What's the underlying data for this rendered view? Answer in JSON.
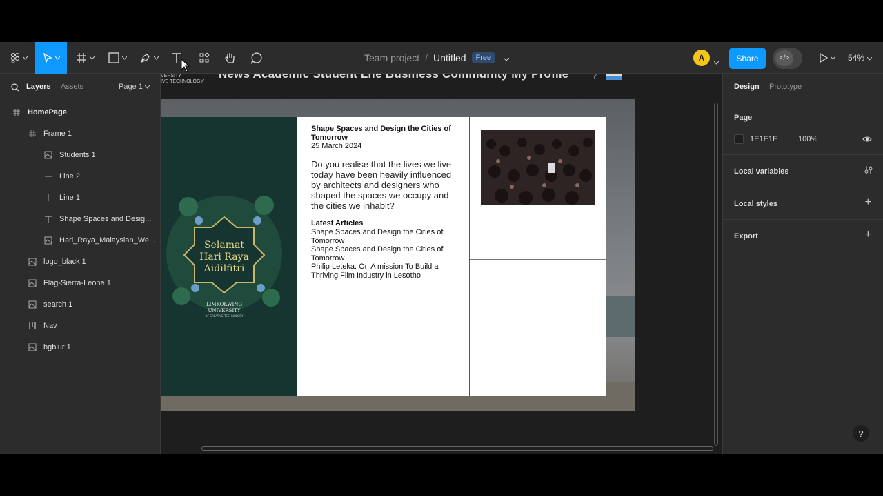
{
  "toolbar": {
    "breadcrumb_team": "Team project",
    "breadcrumb_separator": "/",
    "file_name": "Untitled",
    "plan_badge": "Free",
    "avatar_initial": "A",
    "share_label": "Share",
    "zoom_level": "54%",
    "accent_color": "#0d99ff"
  },
  "left_panel": {
    "tabs": [
      "Layers",
      "Assets"
    ],
    "page_selector": "Page 1",
    "layers": [
      {
        "name": "HomePage",
        "icon": "frame-icon"
      },
      {
        "name": "Frame 1",
        "icon": "frame-icon"
      },
      {
        "name": "Students 1",
        "icon": "image-icon"
      },
      {
        "name": "Line 2",
        "icon": "line-icon"
      },
      {
        "name": "Line 1",
        "icon": "line-icon"
      },
      {
        "name": "Shape Spaces and Desig...",
        "icon": "text-icon"
      },
      {
        "name": "Hari_Raya_Malaysian_We...",
        "icon": "image-icon"
      },
      {
        "name": "logo_black 1",
        "icon": "image-icon"
      },
      {
        "name": "Flag-Sierra-Leone 1",
        "icon": "image-icon"
      },
      {
        "name": "search 1",
        "icon": "image-icon"
      },
      {
        "name": "Nav",
        "icon": "auto-layout-icon"
      },
      {
        "name": "bgblur 1",
        "icon": "image-icon"
      }
    ]
  },
  "canvas": {
    "nav_items": "News  Academic  Student Life  Business  Community  My Profile",
    "logo_text": "VERSITY\nIVE TECHNOLOGY",
    "poster": {
      "line1": "Selamat",
      "line2": "Hari Raya",
      "line3": "Aidilfitri",
      "uni1": "LIMKOKWING",
      "uni2": "UNIVERSITY",
      "uni3": "OF CREATIVE TECHNOLOGY"
    },
    "article": {
      "title": "Shape Spaces and Design the Cities of Tomorrow",
      "date": "25 March 2024",
      "body": "Do you realise that the lives we live today have been heavily influenced by architects and designers who shaped the spaces we occupy and the cities we inhabit?",
      "latest_heading": "Latest Articles",
      "latest": [
        "Shape Spaces and Design the Cities of Tomorrow",
        "Shape Spaces and Design the Cities of Tomorrow",
        "Philip Leteka: On A mission To Build a Thriving Film Industry in Lesotho"
      ]
    }
  },
  "right_panel": {
    "tabs": [
      "Design",
      "Prototype"
    ],
    "page_heading": "Page",
    "page_color": "1E1E1E",
    "page_opacity": "100%",
    "local_variables": "Local variables",
    "local_styles": "Local styles",
    "export": "Export"
  },
  "help": "?"
}
